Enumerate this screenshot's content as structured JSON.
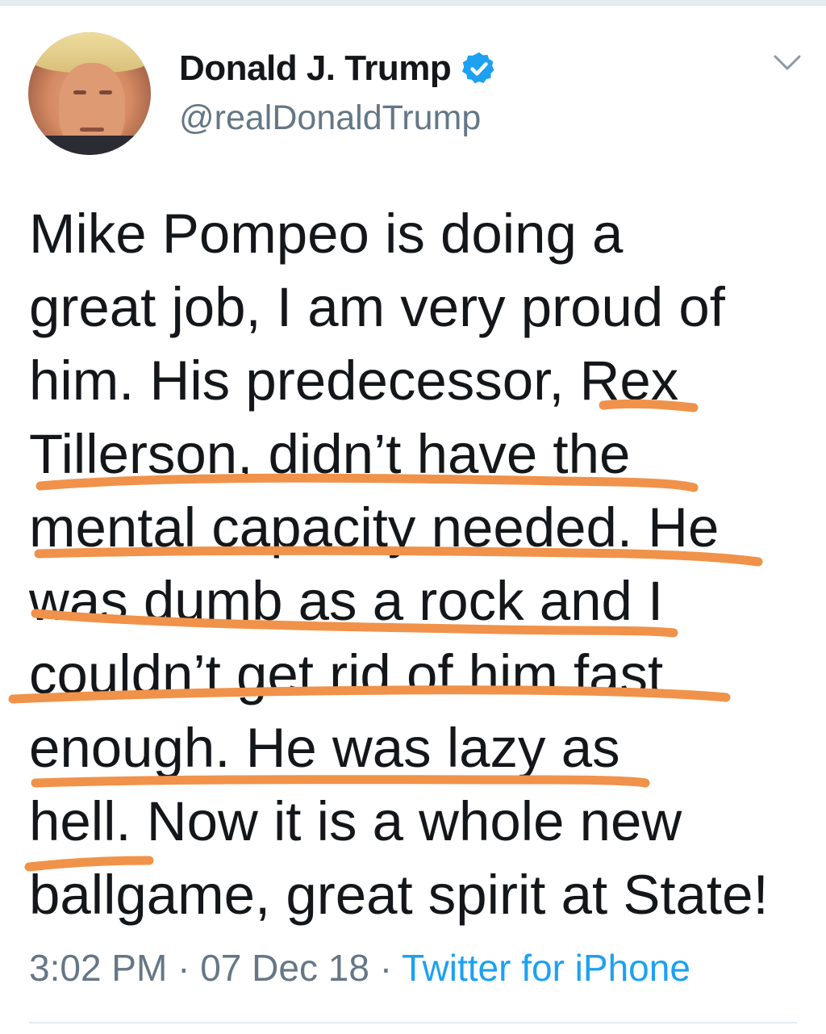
{
  "tweet": {
    "author": {
      "display_name": "Donald J. Trump",
      "handle": "@realDonaldTrump",
      "verified_icon": "verified-badge-icon"
    },
    "menu_icon": "chevron-down-icon",
    "lines": [
      "Mike Pompeo is doing a",
      "great job, I am very proud of",
      "him. His predecessor, Rex",
      "Tillerson, didn’t have the",
      "mental capacity needed. He",
      "was dumb as a rock and I",
      "couldn’t get rid of him fast",
      "enough. He was lazy as",
      "hell. Now it is a whole new",
      "ballgame, great spirit at State!"
    ],
    "time": "3:02 PM",
    "separator": "·",
    "date": "07 Dec 18",
    "source": "Twitter for iPhone"
  },
  "colors": {
    "text": "#14171a",
    "muted": "#657786",
    "link": "#1da1f2",
    "underline_marker": "#f0924a"
  }
}
